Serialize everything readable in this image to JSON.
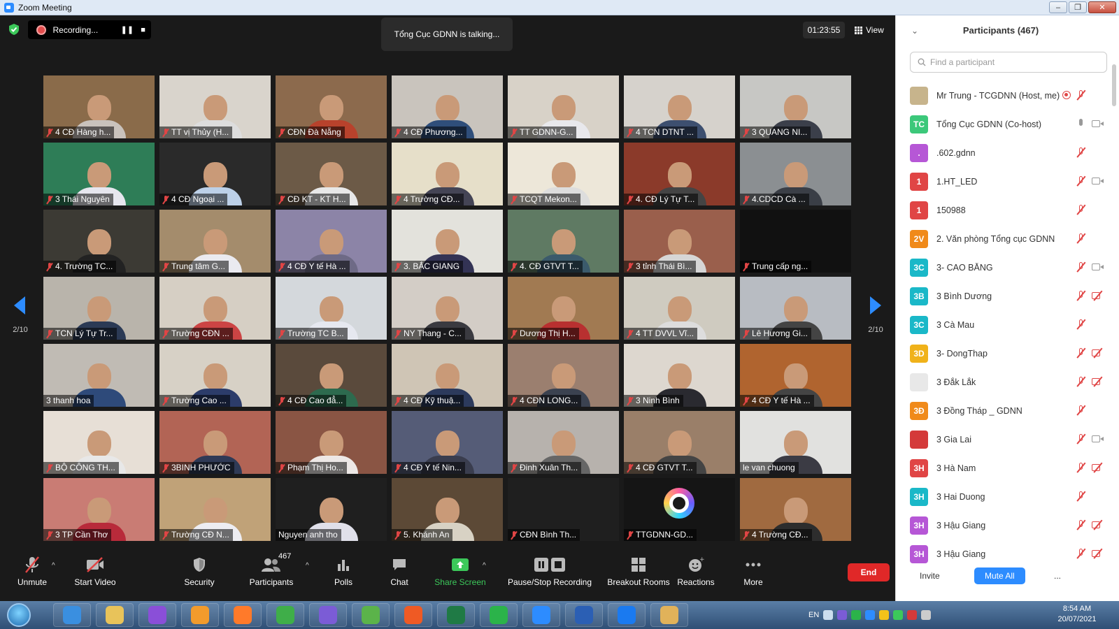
{
  "window": {
    "title": "Zoom Meeting"
  },
  "top_bar": {
    "recording_label": "Recording...",
    "pause_icon": "pause-icon",
    "stop_icon": "stop-icon",
    "talking_text": "Tổng Cục GDNN is talking...",
    "timer": "01:23:55",
    "view_label": "View"
  },
  "pagination": {
    "left": "2/10",
    "right": "2/10"
  },
  "tiles": [
    {
      "label": "4 CĐ Hàng h...",
      "muted": true,
      "bg": "#8a6b4a",
      "shirt": "#c9c2bc"
    },
    {
      "label": "TT vị Thủy (H...",
      "muted": true,
      "bg": "#d9d4cc",
      "shirt": "#ddd"
    },
    {
      "label": "CĐN Đà Nẵng",
      "muted": true,
      "bg": "#8c6a4d",
      "shirt": "#b8422c"
    },
    {
      "label": "4 CĐ Phương...",
      "muted": true,
      "bg": "#c9c4bd",
      "shirt": "#2f4e7a"
    },
    {
      "label": "TT GDNN-G...",
      "muted": true,
      "bg": "#d8d2c8",
      "shirt": "#e8e8ec"
    },
    {
      "label": "4 TCN DTNT ...",
      "muted": true,
      "bg": "#d6d2cc",
      "shirt": "#3d4f6f"
    },
    {
      "label": "3 QUANG NI...",
      "muted": true,
      "bg": "#c7c7c4",
      "shirt": "#3b3f4a"
    },
    {
      "label": "3 Thái Nguyên",
      "muted": true,
      "bg": "#2e7d57",
      "shirt": "#e6e6ee"
    },
    {
      "label": "4 CĐ Ngoại ...",
      "muted": true,
      "bg": "#2a2a2a",
      "shirt": "#bcd0e8"
    },
    {
      "label": "CĐ KT - KT H...",
      "muted": true,
      "bg": "#6c5a47",
      "shirt": "#e8e8e8"
    },
    {
      "label": "4 Trường CĐ...",
      "muted": true,
      "bg": "#e6dfc9",
      "shirt": "#445"
    },
    {
      "label": "TCQT Mekon...",
      "muted": true,
      "bg": "#ede7d9",
      "shirt": "#ddd"
    },
    {
      "label": "4. CĐ Lý Tự T...",
      "muted": true,
      "bg": "#8b3a2a",
      "shirt": "#444"
    },
    {
      "label": "4.CDCD Cà ...",
      "muted": true,
      "bg": "#8b8f92",
      "shirt": "#3a3e46"
    },
    {
      "label": "4. Trường TC...",
      "muted": true,
      "bg": "#3c3a34",
      "shirt": "#222"
    },
    {
      "label": "Trung tâm G...",
      "muted": true,
      "bg": "#a48c6c",
      "shirt": "#eaeaf0"
    },
    {
      "label": "4 CĐ Y tế Hà ...",
      "muted": true,
      "bg": "#8c84a7",
      "shirt": "#6e6a86"
    },
    {
      "label": "3. BẮC GIANG",
      "muted": true,
      "bg": "#e3e2dc",
      "shirt": "#335"
    },
    {
      "label": "4. CĐ GTVT T...",
      "muted": true,
      "bg": "#5f7a63",
      "shirt": "#3b5a6b"
    },
    {
      "label": "3 tỉnh Thái Bì...",
      "muted": true,
      "bg": "#9a5f4c",
      "shirt": "#d6d6d6"
    },
    {
      "label": "Trung cấp ng...",
      "muted": true,
      "bg": "#111111",
      "shirt": ""
    },
    {
      "label": "TCN Lý Tự Tr...",
      "muted": true,
      "bg": "#b9b4ab",
      "shirt": "#2b3a55"
    },
    {
      "label": "Trường CĐN ...",
      "muted": true,
      "bg": "#d6cfc4",
      "shirt": "#c44"
    },
    {
      "label": "Trường TC B...",
      "muted": true,
      "bg": "#d4d8dc",
      "shirt": "#e6e8f0"
    },
    {
      "label": "NY Thang - C...",
      "muted": true,
      "bg": "#d3cdc6",
      "shirt": "#3a3a40"
    },
    {
      "label": "Dương Thị H...",
      "muted": true,
      "bg": "#a17a52",
      "shirt": "#b83030"
    },
    {
      "label": "4 TT DVVL Vĩ...",
      "muted": true,
      "bg": "#cfcbc0",
      "shirt": "#ddd"
    },
    {
      "label": "Lê Hương Gi...",
      "muted": true,
      "bg": "#b8bcc2",
      "shirt": "#444"
    },
    {
      "label": "3 thanh hoa",
      "muted": false,
      "bg": "#c0bbb4",
      "shirt": "#2e4a7a"
    },
    {
      "label": "Trường Cao ...",
      "muted": true,
      "bg": "#d7d1c6",
      "shirt": "#2c3c6a"
    },
    {
      "label": "4 CĐ Cao đẳ...",
      "muted": true,
      "bg": "#5a4a3c",
      "shirt": "#2d6a4e"
    },
    {
      "label": "4 CĐ Kỹ thuậ...",
      "muted": true,
      "bg": "#cfc5b5",
      "shirt": "#2c3a5c"
    },
    {
      "label": "4 CĐN LONG...",
      "muted": true,
      "bg": "#9b7f6f",
      "shirt": "#3b4250"
    },
    {
      "label": "3 Ninh Bình",
      "muted": true,
      "bg": "#ddd7cf",
      "shirt": "#2a2a30"
    },
    {
      "label": "4 CĐ Y tế Hà ...",
      "muted": true,
      "bg": "#b0642f",
      "shirt": "#444"
    },
    {
      "label": "BỘ CÔNG TH...",
      "muted": true,
      "bg": "#e7dfd6",
      "shirt": "#e8e8e8"
    },
    {
      "label": "3BINH PHƯỚC",
      "muted": true,
      "bg": "#b26455",
      "shirt": "#2f3a56"
    },
    {
      "label": "Phạm Thị Ho...",
      "muted": true,
      "bg": "#8a5544",
      "shirt": "#ede8e6"
    },
    {
      "label": "4 CĐ Y tế Nin...",
      "muted": true,
      "bg": "#555c77",
      "shirt": "#3a3d4e"
    },
    {
      "label": "Đinh Xuân Th...",
      "muted": true,
      "bg": "#b7b2ad",
      "shirt": "#666"
    },
    {
      "label": "4 CĐ GTVT T...",
      "muted": true,
      "bg": "#9a7f69",
      "shirt": "#444"
    },
    {
      "label": "le van chuong",
      "muted": false,
      "bg": "#e1e1df",
      "shirt": "#3b3b44"
    },
    {
      "label": "3 TP Cần Thơ",
      "muted": true,
      "bg": "#c97c74",
      "shirt": "#b82a3a"
    },
    {
      "label": "Trường CĐ N...",
      "muted": true,
      "bg": "#c0a278",
      "shirt": "#ededf2"
    },
    {
      "label": "Nguyen anh tho",
      "muted": false,
      "bg": "#1f1f1f",
      "shirt": "#e0e0ea"
    },
    {
      "label": "5. Khánh An",
      "muted": true,
      "bg": "#5c4936",
      "shirt": "#d8d2c4"
    },
    {
      "label": "CĐN Bình Th...",
      "muted": true,
      "bg": "#1f1f1f",
      "shirt": ""
    },
    {
      "label": "TTGDNN-GD...",
      "muted": true,
      "bg": "#151515",
      "shirt": ""
    },
    {
      "label": "4 Trường CĐ...",
      "muted": true,
      "bg": "#a06a40",
      "shirt": "#2d2d2d"
    }
  ],
  "toolbar": {
    "unmute": "Unmute",
    "start_video": "Start Video",
    "security": "Security",
    "participants": "Participants",
    "participants_count": "467",
    "polls": "Polls",
    "chat": "Chat",
    "share_screen": "Share Screen",
    "pause_stop": "Pause/Stop Recording",
    "breakout": "Breakout Rooms",
    "reactions": "Reactions",
    "more": "More",
    "end": "End"
  },
  "panel": {
    "title": "Participants (467)",
    "search_placeholder": "Find a participant",
    "invite": "Invite",
    "mute_all": "Mute All",
    "more": "...",
    "participants": [
      {
        "initials": "",
        "color": "#c7b48c",
        "name": "Mr Trung - TCGDNN (Host, me)",
        "mic": "muted",
        "cam": "none",
        "rec": true
      },
      {
        "initials": "TC",
        "color": "#3cc87a",
        "name": "Tổng Cục GDNN (Co-host)",
        "mic": "on",
        "cam": "on",
        "rec": false
      },
      {
        "initials": ".",
        "color": "#b657d6",
        "name": ".602.gdnn",
        "mic": "muted",
        "cam": "none",
        "rec": false
      },
      {
        "initials": "1",
        "color": "#e04545",
        "name": "1.HT_LED",
        "mic": "muted",
        "cam": "on",
        "rec": false
      },
      {
        "initials": "1",
        "color": "#e04545",
        "name": "150988",
        "mic": "muted",
        "cam": "none",
        "rec": false
      },
      {
        "initials": "2V",
        "color": "#f08a1a",
        "name": "2. Văn phòng Tổng cục GDNN",
        "mic": "muted",
        "cam": "none",
        "rec": false
      },
      {
        "initials": "3C",
        "color": "#1ab8c8",
        "name": "3-  CAO BẰNG",
        "mic": "muted",
        "cam": "on",
        "rec": false
      },
      {
        "initials": "3B",
        "color": "#1ab8c8",
        "name": "3 Bình Dương",
        "mic": "muted",
        "cam": "off",
        "rec": false
      },
      {
        "initials": "3C",
        "color": "#1ab8c8",
        "name": "3 Cà Mau",
        "mic": "muted",
        "cam": "none",
        "rec": false
      },
      {
        "initials": "3D",
        "color": "#f0b21a",
        "name": "3- DongThap",
        "mic": "muted",
        "cam": "off",
        "rec": false
      },
      {
        "initials": "",
        "color": "#e8e8e8",
        "name": "3 Đắk Lắk",
        "mic": "muted",
        "cam": "off",
        "rec": false
      },
      {
        "initials": "3Đ",
        "color": "#f08a1a",
        "name": "3 Đồng Tháp _ GDNN",
        "mic": "muted",
        "cam": "none",
        "rec": false
      },
      {
        "initials": "",
        "color": "#d43a3a",
        "name": "3 Gia Lai",
        "mic": "muted",
        "cam": "on",
        "rec": false
      },
      {
        "initials": "3H",
        "color": "#e04545",
        "name": "3 Hà Nam",
        "mic": "muted",
        "cam": "off",
        "rec": false
      },
      {
        "initials": "3H",
        "color": "#1ab8c8",
        "name": "3 Hai Duong",
        "mic": "muted",
        "cam": "none",
        "rec": false
      },
      {
        "initials": "3H",
        "color": "#b657d6",
        "name": "3 Hậu Giang",
        "mic": "muted",
        "cam": "off",
        "rec": false
      },
      {
        "initials": "3H",
        "color": "#b657d6",
        "name": "3 Hậu Giang",
        "mic": "muted",
        "cam": "off",
        "rec": false
      }
    ]
  },
  "taskbar": {
    "lang": "EN",
    "time": "8:54 AM",
    "date": "20/07/2021",
    "apps": [
      {
        "name": "ie-icon",
        "color": "#3a8fe0"
      },
      {
        "name": "explorer-icon",
        "color": "#e8c35a"
      },
      {
        "name": "media-icon",
        "color": "#8a4fd8"
      },
      {
        "name": "player-icon",
        "color": "#f29b2c"
      },
      {
        "name": "firefox-icon",
        "color": "#ff7a2a"
      },
      {
        "name": "chrome-icon",
        "color": "#3fae49"
      },
      {
        "name": "viber-icon",
        "color": "#7b5cd6"
      },
      {
        "name": "coccoc-icon",
        "color": "#5bb34a"
      },
      {
        "name": "foxit-icon",
        "color": "#ef5a24"
      },
      {
        "name": "excel-icon",
        "color": "#1f7a45"
      },
      {
        "name": "play-icon",
        "color": "#2bb34a"
      },
      {
        "name": "zoom-icon",
        "color": "#2d8cff"
      },
      {
        "name": "word-icon",
        "color": "#2b5fb4"
      },
      {
        "name": "zalo-icon",
        "color": "#1a7af0"
      },
      {
        "name": "paint-icon",
        "color": "#e1b25a"
      }
    ]
  }
}
